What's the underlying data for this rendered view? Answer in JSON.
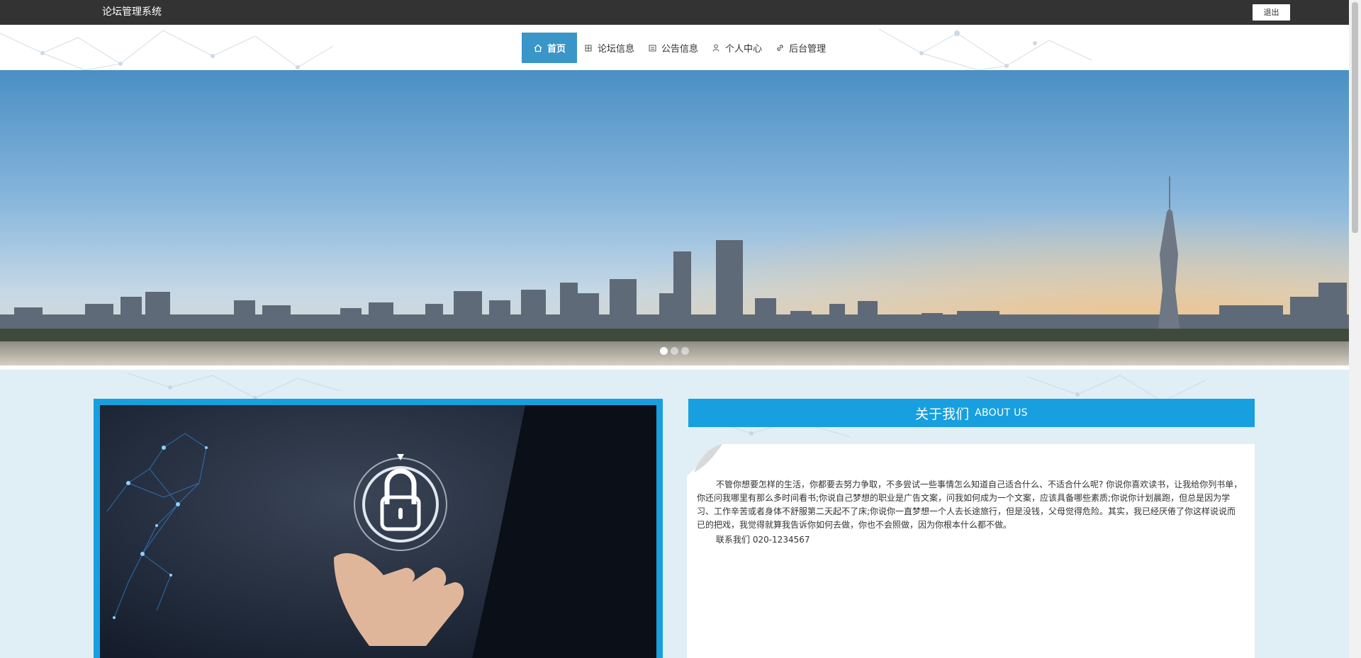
{
  "header": {
    "brand": "论坛管理系统",
    "logout_label": "退出"
  },
  "nav": {
    "items": [
      {
        "label": "首页",
        "icon": "home-icon",
        "active": true
      },
      {
        "label": "论坛信息",
        "icon": "grid-icon",
        "active": false
      },
      {
        "label": "公告信息",
        "icon": "notice-icon",
        "active": false
      },
      {
        "label": "个人中心",
        "icon": "user-icon",
        "active": false
      },
      {
        "label": "后台管理",
        "icon": "link-icon",
        "active": false
      }
    ]
  },
  "banner": {
    "slides": 3,
    "active_slide": 1
  },
  "about": {
    "title_cn": "关于我们",
    "title_en": "ABOUT US",
    "text": "不管你想要怎样的生活，你都要去努力争取，不多尝试一些事情怎么知道自己适合什么、不适合什么呢? 你说你喜欢读书，让我给你列书单，你还问我哪里有那么多时间看书;你说自己梦想的职业是广告文案，问我如何成为一个文案，应该具备哪些素质;你说你计划晨跑，但总是因为学习、工作辛苦或者身体不舒服第二天起不了床;你说你一直梦想一个人去长途旅行，但是没钱，父母觉得危险。其实，我已经厌倦了你这样说说而已的把戏，我觉得就算我告诉你如何去做，你也不会照做，因为你根本什么都不做。",
    "contact": "联系我们 020-1234567"
  },
  "colors": {
    "topbar": "#333333",
    "accent": "#189fdf",
    "nav_active": "#3a95c8",
    "content_bg": "#e0eef5"
  }
}
